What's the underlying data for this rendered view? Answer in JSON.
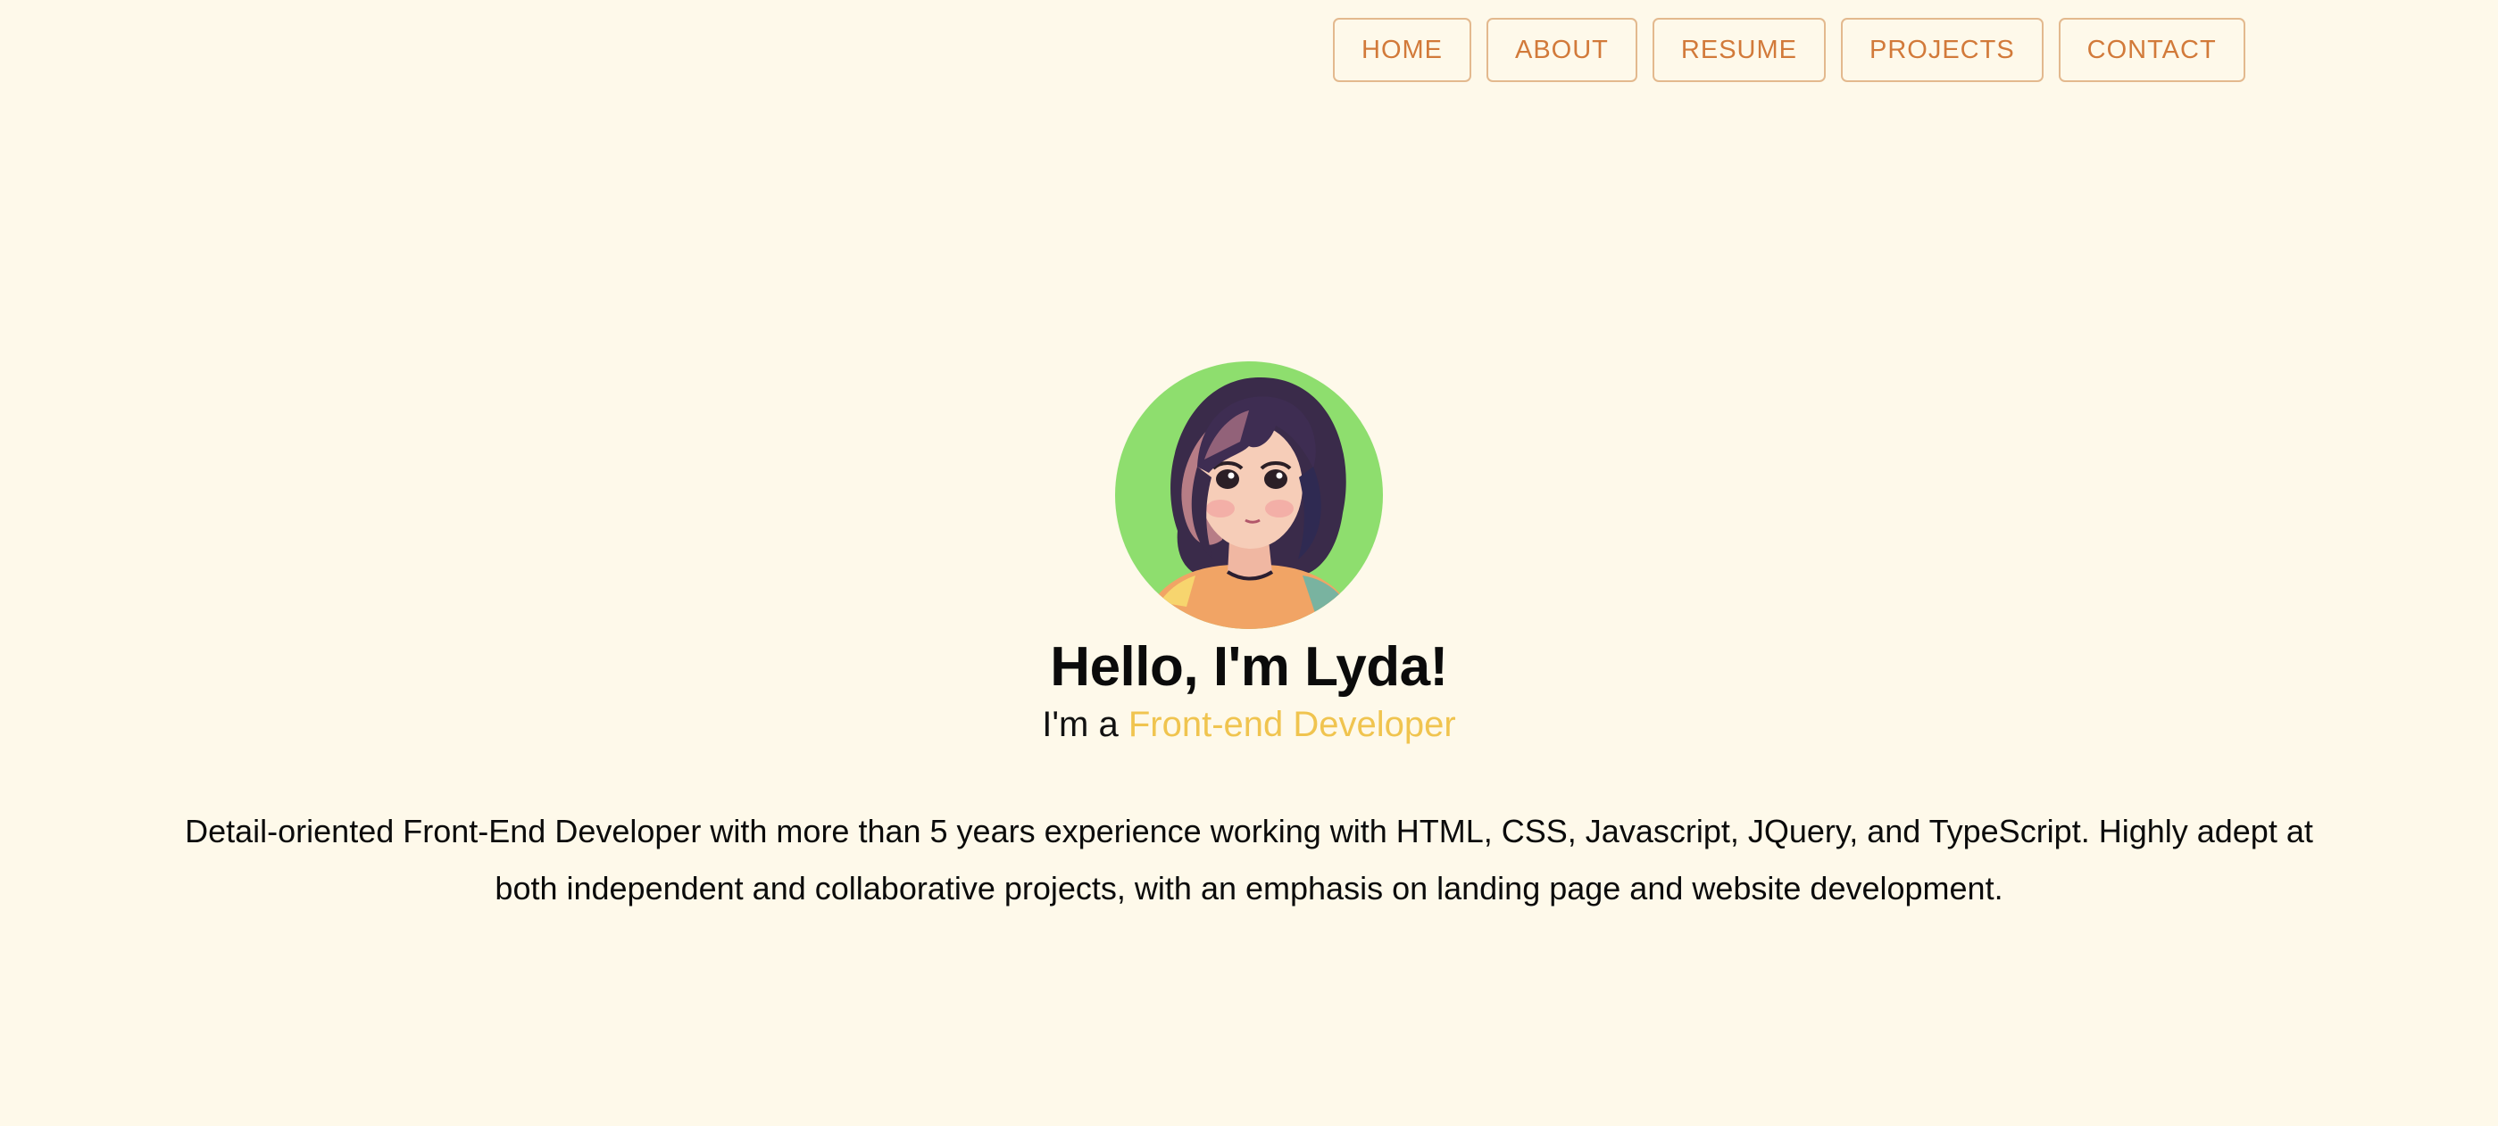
{
  "nav": {
    "items": [
      {
        "label": "HOME"
      },
      {
        "label": "ABOUT"
      },
      {
        "label": "RESUME"
      },
      {
        "label": "PROJECTS"
      },
      {
        "label": "CONTACT"
      }
    ]
  },
  "hero": {
    "title": "Hello, I'm Lyda!",
    "subtitle_prefix": "I'm a ",
    "subtitle_role": "Front-end Developer",
    "bio": "Detail-oriented Front-End Developer with more than 5 years experience working with HTML, CSS, Javascript, JQuery, and TypeScript. Highly adept at both independent and collaborative projects, with an emphasis on landing page and website development."
  },
  "colors": {
    "background": "#fef9ea",
    "nav_text": "#d27a3a",
    "nav_border": "#e3b98e",
    "accent": "#f0c44f",
    "avatar_bg": "#8ede6e"
  }
}
